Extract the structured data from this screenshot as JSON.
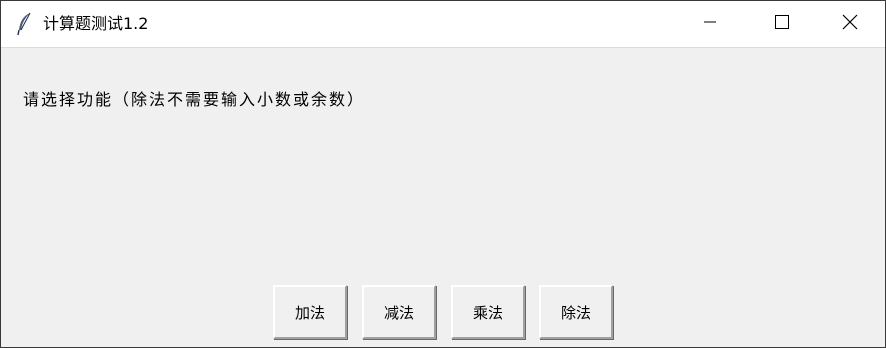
{
  "window": {
    "title": "计算题测试1.2",
    "icon": "feather-icon",
    "controls": {
      "minimize_icon": "minimize-icon",
      "maximize_icon": "maximize-icon",
      "close_icon": "close-icon"
    }
  },
  "main": {
    "prompt": "请选择功能（除法不需要输入小数或余数）",
    "buttons": [
      {
        "label": "加法"
      },
      {
        "label": "减法"
      },
      {
        "label": "乘法"
      },
      {
        "label": "除法"
      }
    ]
  }
}
